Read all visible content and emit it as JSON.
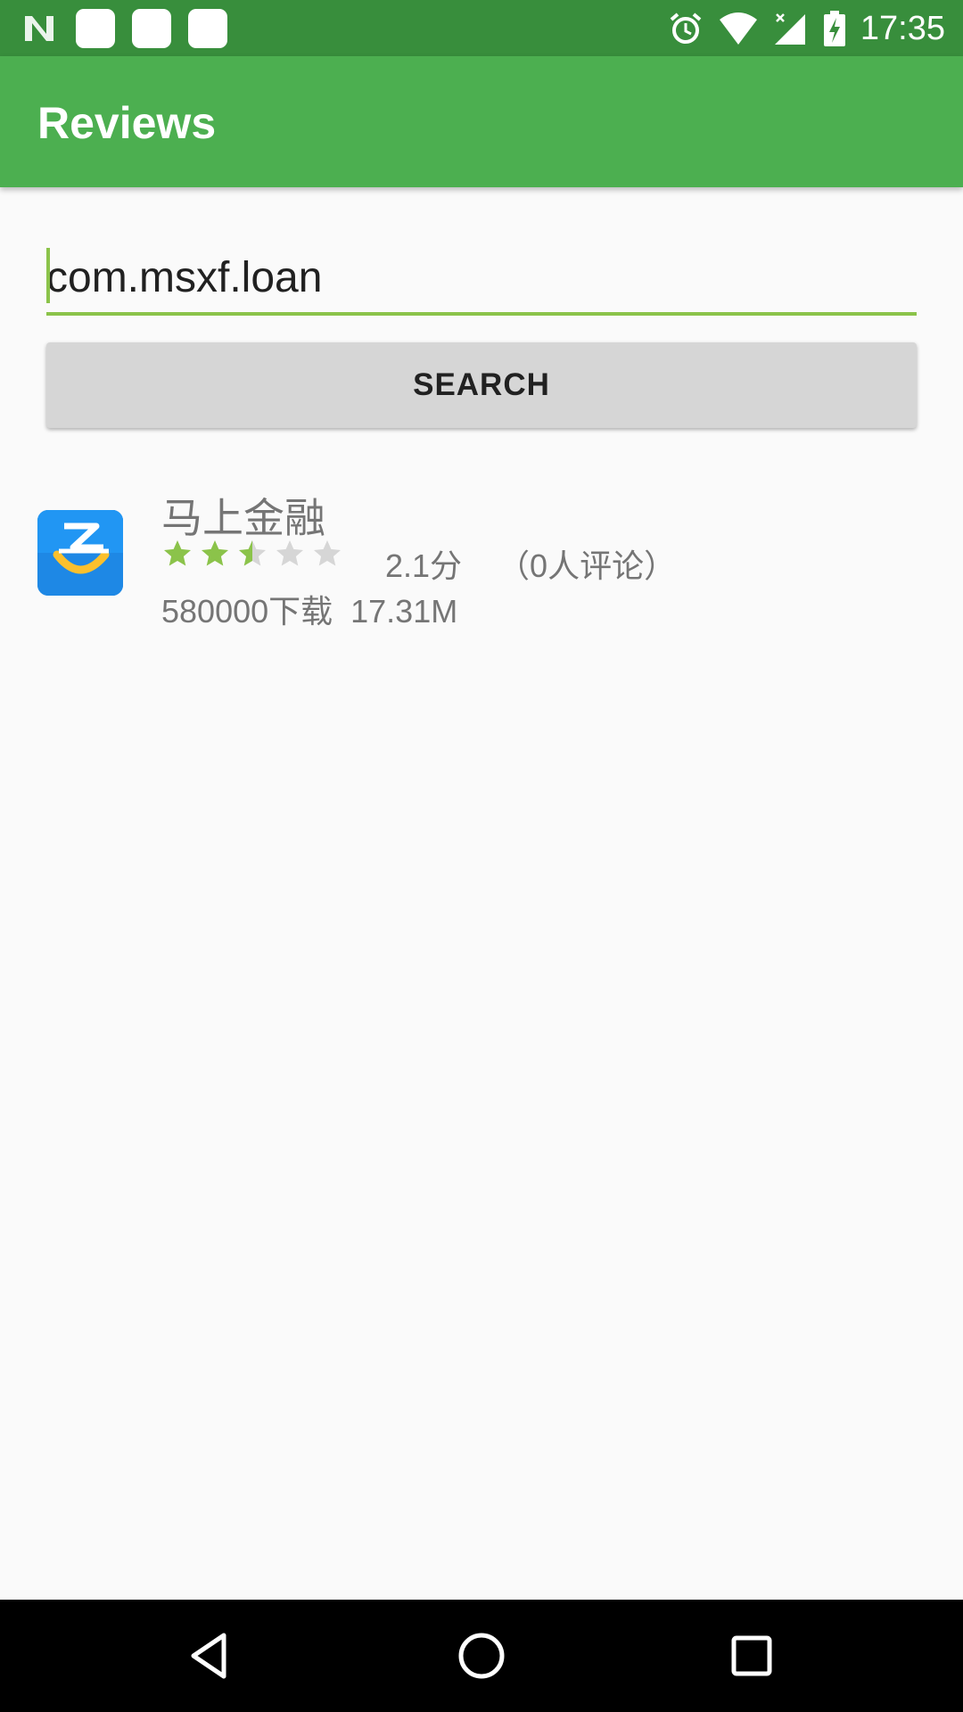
{
  "status_bar": {
    "time": "17:35",
    "icons": [
      "n-logo-icon",
      "notification-icon",
      "notification-icon",
      "notification-icon",
      "alarm-icon",
      "wifi-icon",
      "signal-icon",
      "battery-charging-icon"
    ]
  },
  "app_bar": {
    "title": "Reviews"
  },
  "search": {
    "value": "com.msxf.loan",
    "button_label": "SEARCH"
  },
  "results": [
    {
      "name": "马上金融",
      "rating": 2.1,
      "rating_text": "2.1分",
      "review_count_text": "（0人评论）",
      "downloads_text": "580000下载",
      "size_text": "17.31M",
      "icon": "app-icon"
    }
  ],
  "colors": {
    "status_bar": "#388e3c",
    "app_bar": "#4caf50",
    "accent": "#8bc34a",
    "star_empty": "#d6d6d6"
  },
  "nav_bar": {
    "icons": [
      "back-icon",
      "home-icon",
      "recents-icon"
    ]
  }
}
